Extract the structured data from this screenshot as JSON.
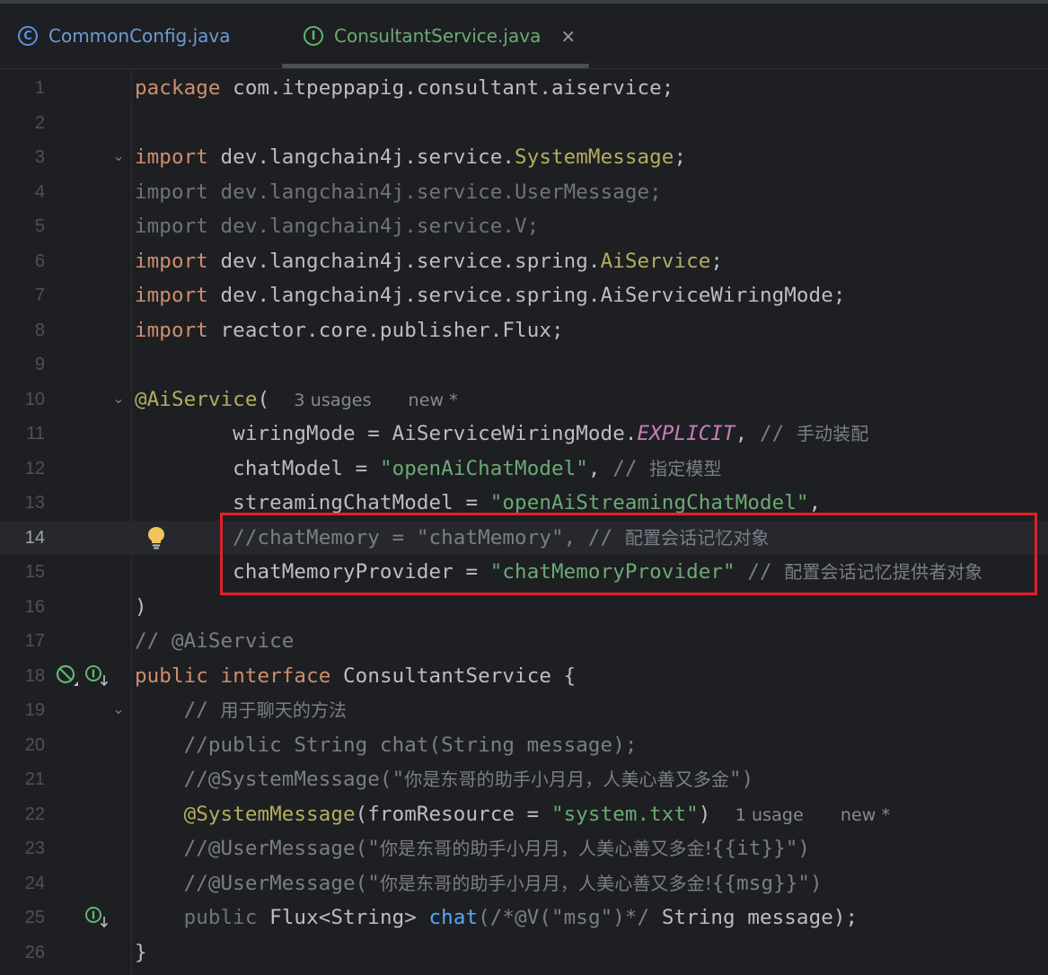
{
  "tabs": [
    {
      "label": "CommonConfig.java",
      "icon": "class-icon",
      "icon_letter": "C"
    },
    {
      "label": "ConsultantService.java",
      "icon": "interface-icon",
      "icon_letter": "I",
      "close": "×"
    }
  ],
  "editor": {
    "line_numbers": [
      "1",
      "2",
      "3",
      "4",
      "5",
      "6",
      "7",
      "8",
      "9",
      "10",
      "11",
      "12",
      "13",
      "14",
      "15",
      "16",
      "17",
      "18",
      "19",
      "20",
      "21",
      "22",
      "23",
      "24",
      "25",
      "26"
    ],
    "current_line": "14",
    "lines": {
      "l1": {
        "kw": "package",
        "rest": " com.itpeppapig.consultant.aiservice;"
      },
      "l3": {
        "kw": "import",
        "a": " dev.langchain4j.service.",
        "cls": "SystemMessage",
        "end": ";"
      },
      "l4": {
        "text": "import dev.langchain4j.service.UserMessage;"
      },
      "l5": {
        "text": "import dev.langchain4j.service.V;"
      },
      "l6": {
        "kw": "import",
        "a": " dev.langchain4j.service.spring.",
        "cls": "AiService",
        "end": ";"
      },
      "l7": {
        "kw": "import",
        "a": " dev.langchain4j.service.spring.AiServiceWiringMode;"
      },
      "l8": {
        "kw": "import",
        "a": " reactor.core.publisher.Flux;"
      },
      "l10": {
        "ann": "@AiService",
        "a": "(",
        "hint1": "3 usages",
        "hint2": "new *"
      },
      "l11": {
        "a": "        wiringMode = AiServiceWiringMode.",
        "field": "EXPLICIT",
        "b": ", ",
        "cmt": "// ",
        "cn": "手动装配"
      },
      "l12": {
        "a": "        chatModel = ",
        "str": "\"openAiChatModel\"",
        "b": ", ",
        "cmt": "// ",
        "cn": "指定模型"
      },
      "l13": {
        "a": "        streamingChatModel = ",
        "str": "\"openAiStreamingChatModel\"",
        "b": ","
      },
      "l14": {
        "cmt": "        //chatMemory = \"chatMemory\", // ",
        "cn": "配置会话记忆对象"
      },
      "l15": {
        "a": "        chatMemoryProvider = ",
        "str": "\"chatMemoryProvider\"",
        "b": " ",
        "cmt": "// ",
        "cn": "配置会话记忆提供者对象"
      },
      "l16": {
        "a": ")"
      },
      "l17": {
        "cmt": "// @AiService"
      },
      "l18": {
        "kw1": "public",
        "kw2": "interface",
        "a": " ConsultantService {"
      },
      "l19": {
        "cmt": "    // ",
        "cn": "用于聊天的方法"
      },
      "l20": {
        "cmt": "    //public String chat(String message);"
      },
      "l21": {
        "cmt": "    //@SystemMessage(\"",
        "cn": "你是东哥的助手小月月，人美心善又多金",
        "cmt2": "\")"
      },
      "l22": {
        "ann": "@SystemMessage",
        "a": "(fromResource = ",
        "str": "\"system.txt\"",
        "b": ")",
        "hint1": "1 usage",
        "hint2": "new *"
      },
      "l23": {
        "cmt": "    //@UserMessage(\"",
        "cn": "你是东哥的助手小月月，人美心善又多金!",
        "cmt2": "{{it}}\")"
      },
      "l24": {
        "cmt": "    //@UserMessage(\"",
        "cn": "你是东哥的助手小月月，人美心善又多金!",
        "cmt2": "{{msg}}\")"
      },
      "l25": {
        "kw": "public",
        "a": " Flux<String> ",
        "method": "chat",
        "cmt": "(/*@V(\"msg\")*/",
        "b": " String message);"
      },
      "l26": {
        "a": "}"
      }
    }
  },
  "colors": {
    "background": "#1e1f22",
    "keyword": "#cf8e6d",
    "annotation": "#b3ae60",
    "string": "#6aab73",
    "comment": "#7a7e85",
    "highlight_box": "#e0202a"
  }
}
